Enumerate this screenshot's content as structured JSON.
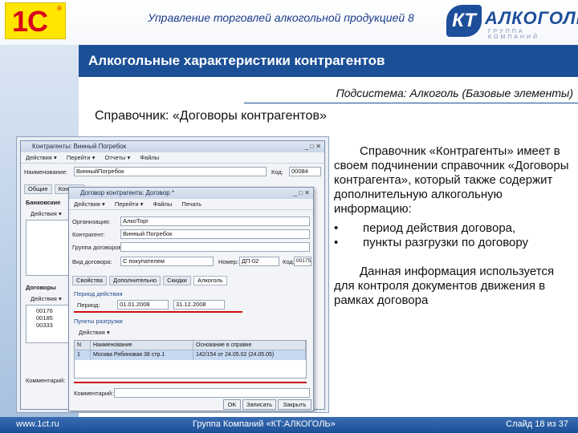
{
  "header": {
    "logo_1c_text": "1С",
    "logo_1c_reg": "®",
    "app_title": "Управление торговлей алкогольной продукцией 8",
    "logo_kt_mark": "КТ",
    "logo_kt_name": "АЛКОГОЛЬ",
    "logo_kt_sub": "ГРУППА КОМПАНИЙ"
  },
  "slide": {
    "title": "Алкогольные характеристики контрагентов",
    "subsystem": "Подсистема: Алкоголь (Базовые элементы)",
    "directory": "Справочник: «Договоры контрагентов»"
  },
  "description": {
    "p1": "Справочник «Контрагенты» имеет в своем подчинении справочник «Договоры контрагента», который также содержит дополнительную алкогольную информацию:",
    "bullets": [
      "период действия договора,",
      "пункты разгрузки по договору"
    ],
    "bullet_mark": "•",
    "p2": "Данная информация используется для контроля документов движения в рамках договора"
  },
  "screenshot": {
    "outer": {
      "title": "Контрагенты: Винный Погребок",
      "toolbar": [
        "Действия ▾",
        "Перейти ▾",
        "Отчеты ▾",
        "Файлы"
      ],
      "name_label": "Наименование:",
      "name_value": "ВинныйПогребок",
      "code_label": "Код:",
      "code_value": "00084",
      "tabs": [
        "Общие",
        "Контакт"
      ],
      "bank_label": "Банковские",
      "actions_label": "Действия ▾",
      "contracts_label": "Договоры",
      "contract_codes": [
        "00176",
        "00185",
        "00333"
      ],
      "comment_label": "Комментарий:"
    },
    "inner": {
      "title": "Договор контрагента: Договор *",
      "toolbar": [
        "Действия ▾",
        "Перейти ▾",
        "Файлы",
        "Печать"
      ],
      "org_label": "Организация:",
      "org_value": "АлкоТорг",
      "contractor_label": "Контрагент:",
      "contractor_value": "Винный Погребок",
      "group_label": "Группа договоров:",
      "kind_label": "Вид договора:",
      "kind_value": "С покупателем",
      "number_label": "Номер:",
      "number_value": "ДП-02",
      "code_label": "Код:",
      "code_value": "00175",
      "tabs": [
        "Свойства",
        "Дополнительно",
        "Скидки",
        "Алкоголь"
      ],
      "period_group": "Период действия",
      "period_label": "Период:",
      "period_from": "01.01.2008",
      "period_to": "31.12.2008",
      "unload_group": "Пункты разгрузки",
      "grid_headers": [
        "N",
        "Наименование",
        "Основание в справке"
      ],
      "grid_row": [
        "1",
        "Москва Рябиновая 38 стр.1",
        "142/154 от 24.05.02 (24.05.05)"
      ],
      "comment_label": "Комментарий:",
      "ok": "OK",
      "write": "Записать",
      "close": "Закрыть"
    }
  },
  "footer": {
    "site": "www.1ct.ru",
    "company": "Группа Компаний «КТ:АЛКОГОЛЬ»",
    "slide_num": "Слайд 18 из 37"
  }
}
